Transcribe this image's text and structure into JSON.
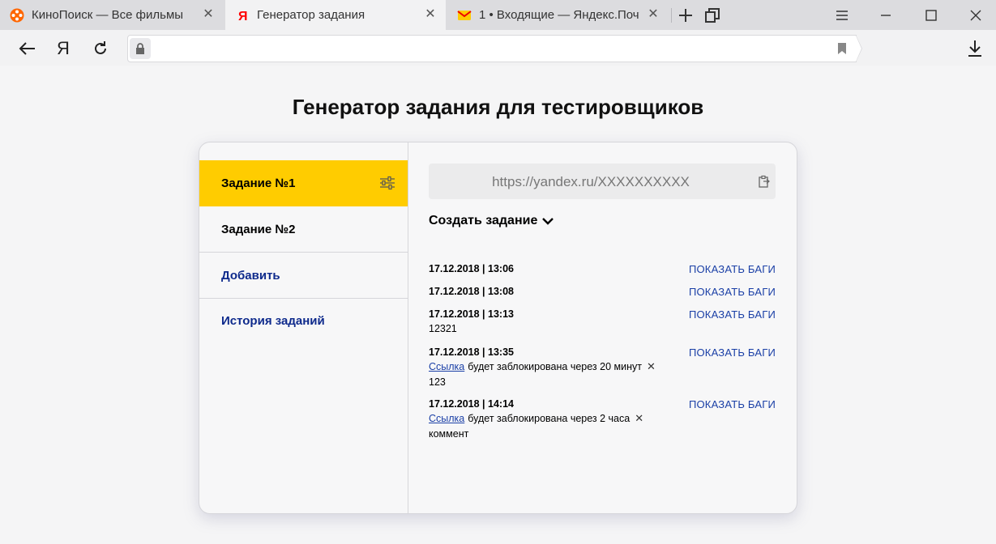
{
  "browser": {
    "tabs": [
      {
        "title": "КиноПоиск — Все фильмы",
        "icon": "kinopoisk-icon"
      },
      {
        "title": "Генератор задания",
        "icon": "yandex-icon"
      },
      {
        "title": "1 • Входящие — Яндекс.Почт",
        "icon": "yandex-mail-icon"
      }
    ],
    "toolbar": {
      "yandex_button": "Я"
    }
  },
  "page": {
    "title": "Генератор задания для тестировщиков",
    "sidebar": {
      "items": [
        {
          "label": "Задание №1"
        },
        {
          "label": "Задание №2"
        },
        {
          "label": "Добавить"
        },
        {
          "label": "История заданий"
        }
      ]
    },
    "url_box": {
      "value": "https://yandex.ru/XXXXXXXXXX"
    },
    "create_label": "Создать задание",
    "entries": [
      {
        "date": "17.12.2018 | 13:06",
        "action": "ПОКАЗАТЬ БАГИ"
      },
      {
        "date": "17.12.2018 | 13:08",
        "action": "ПОКАЗАТЬ БАГИ"
      },
      {
        "date": "17.12.2018 | 13:13",
        "action": "ПОКАЗАТЬ БАГИ",
        "note": "12321"
      },
      {
        "date": "17.12.2018 | 13:35",
        "action": "ПОКАЗАТЬ БАГИ",
        "link": "Ссылка",
        "link_text": "будет заблокирована через 20 минут",
        "note": "123"
      },
      {
        "date": "17.12.2018 | 14:14",
        "action": "ПОКАЗАТЬ БАГИ",
        "link": "Ссылка",
        "link_text": "будет заблокирована через 2 часа",
        "note": "коммент"
      }
    ]
  },
  "colors": {
    "accent": "#ffcc00",
    "link": "#1a3fa6",
    "nav_link": "#0e2a8c"
  }
}
